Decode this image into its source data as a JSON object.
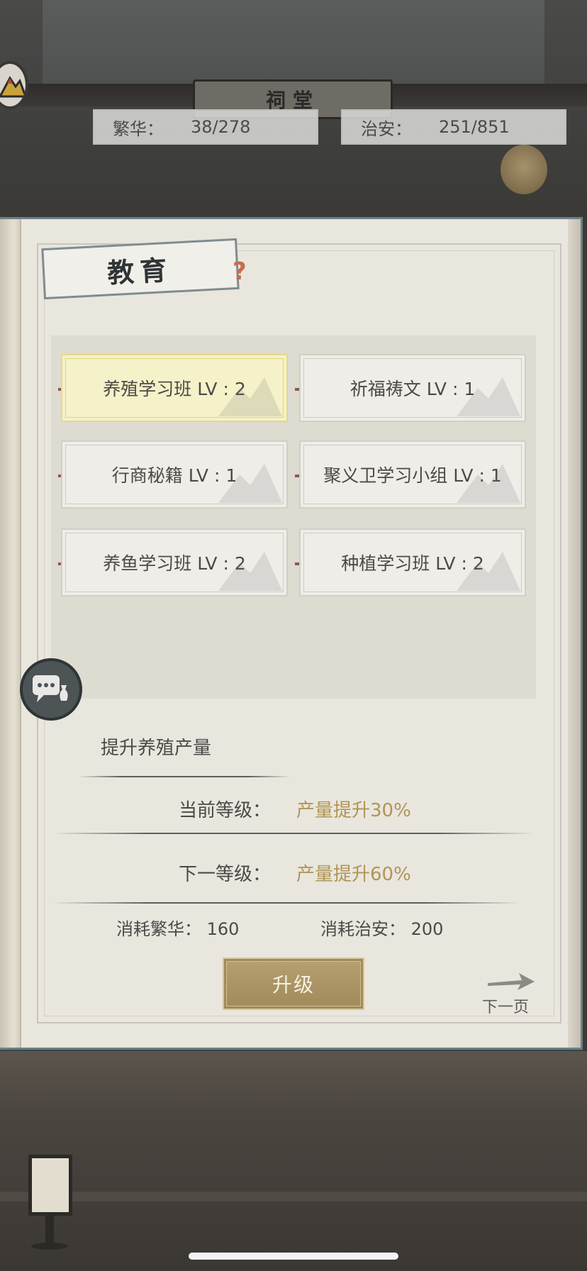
{
  "scene": {
    "plaque_text": "祠堂"
  },
  "stats": {
    "prosperity_label": "繁华：",
    "prosperity_value": "38/278",
    "security_label": "治安：",
    "security_value": "251/851"
  },
  "book": {
    "title": "教育",
    "skills": [
      {
        "label": "养殖学习班 LV : 2",
        "selected": true
      },
      {
        "label": "祈福祷文 LV : 1",
        "selected": false
      },
      {
        "label": "行商秘籍 LV : 1",
        "selected": false
      },
      {
        "label": "聚义卫学习小组 LV : 1",
        "selected": false
      },
      {
        "label": "养鱼学习班 LV : 2",
        "selected": false
      },
      {
        "label": "种植学习班 LV : 2",
        "selected": false
      }
    ],
    "description": "提升养殖产量",
    "current_level_label": "当前等级：",
    "current_level_value": "产量提升30%",
    "next_level_label": "下一等级：",
    "next_level_value": "产量提升60%",
    "cost_prosperity": "消耗繁华： 160",
    "cost_security": "消耗治安： 200",
    "upgrade_label": "升级",
    "next_page_label": "下一页"
  },
  "icons": {
    "avatar": "mountain-avatar-icon",
    "chat": "chat-bubble-icon",
    "next_arrow": "arrow-right-icon",
    "help": "question-knot-icon"
  },
  "colors": {
    "accent_gold": "#b09553",
    "selected_card": "#f5f1c8",
    "book_border": "#6b7f86"
  }
}
